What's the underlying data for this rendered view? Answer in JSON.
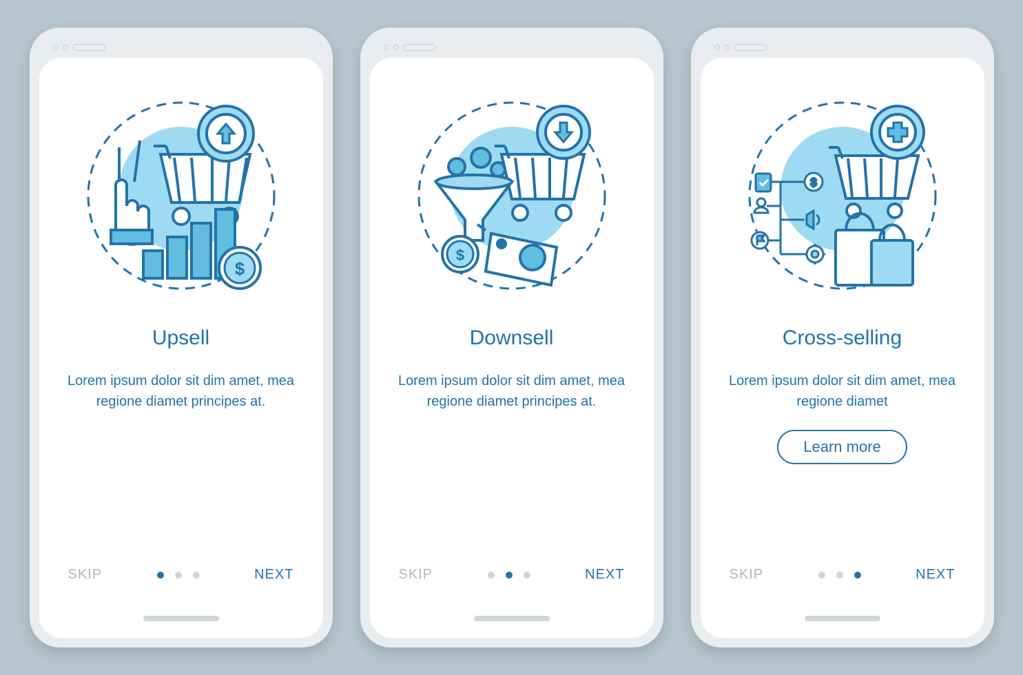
{
  "colors": {
    "accent": "#2273a9",
    "light": "#9edbf2",
    "mid": "#62bde0",
    "muted": "#aeb7bd"
  },
  "screens": [
    {
      "title": "Upsell",
      "description": "Lorem ipsum dolor sit dim amet, mea regione diamet principes at.",
      "skip": "SKIP",
      "next": "NEXT",
      "activeDot": 0,
      "hasLearnMore": false
    },
    {
      "title": "Downsell",
      "description": "Lorem ipsum dolor sit dim amet, mea regione diamet principes at.",
      "skip": "SKIP",
      "next": "NEXT",
      "activeDot": 1,
      "hasLearnMore": false
    },
    {
      "title": "Cross-selling",
      "description": "Lorem ipsum dolor sit dim amet, mea regione diamet",
      "skip": "SKIP",
      "next": "NEXT",
      "activeDot": 2,
      "hasLearnMore": true,
      "learnMore": "Learn more"
    }
  ]
}
